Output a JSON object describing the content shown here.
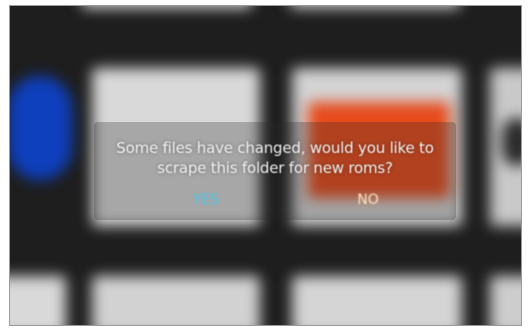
{
  "dialog": {
    "message": "Some files have changed, would you like to\nscrape this folder for new roms?",
    "buttons": {
      "yes": "YES",
      "no": "NO"
    }
  },
  "colors": {
    "background": "#1e1e1f",
    "selected_button_text": "#47c7ea",
    "button_text": "#ffe9c8",
    "dialog_text": "#f2f2f2"
  },
  "tiles": [
    {
      "name": "tile-blue",
      "color": "#0e3fbd",
      "shape": "circle"
    },
    {
      "name": "tile-gray-1",
      "color": "#d9d9d9"
    },
    {
      "name": "tile-red",
      "color": "#e64b1c"
    },
    {
      "name": "tile-gray-2",
      "color": "#c9c9c9"
    },
    {
      "name": "tile-bottom-1",
      "color": "#d9d9d9"
    },
    {
      "name": "tile-bottom-2",
      "color": "#d2d2d2"
    },
    {
      "name": "tile-bottom-3",
      "color": "#d5d5d5"
    },
    {
      "name": "tile-bottom-4",
      "color": "#cdcdcd"
    },
    {
      "name": "tile-top-1",
      "color": "#d8d8d8"
    },
    {
      "name": "tile-top-2",
      "color": "#d0d0d0"
    }
  ]
}
